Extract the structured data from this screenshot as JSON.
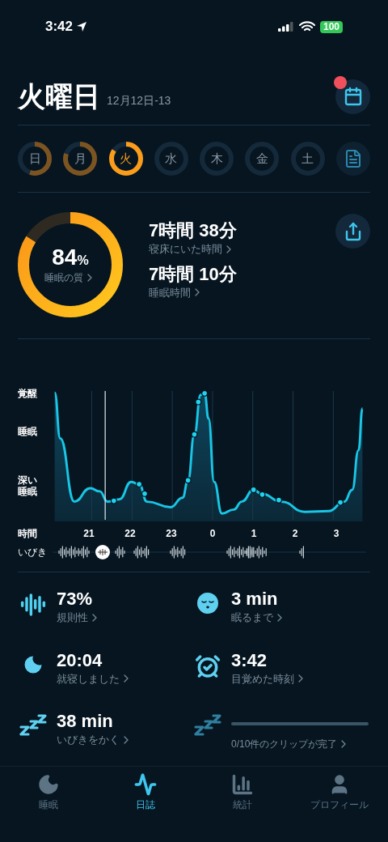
{
  "status_bar": {
    "time": "3:42",
    "battery": "100"
  },
  "header": {
    "title": "火曜日",
    "date": "12月12日-13",
    "notification": true
  },
  "days": [
    {
      "label": "日",
      "level": 0.55,
      "selected": false
    },
    {
      "label": "月",
      "level": 0.8,
      "selected": false
    },
    {
      "label": "火",
      "level": 0.84,
      "selected": true
    },
    {
      "label": "水",
      "level": 0,
      "selected": false
    },
    {
      "label": "木",
      "level": 0,
      "selected": false
    },
    {
      "label": "金",
      "level": 0,
      "selected": false
    },
    {
      "label": "土",
      "level": 0,
      "selected": false
    }
  ],
  "summary": {
    "quality": {
      "value": "84",
      "unit": "%",
      "label": "睡眠の質",
      "level": 0.84
    },
    "metrics": [
      {
        "value": "7時間 38分",
        "label": "寝床にいた時間"
      },
      {
        "value": "7時間 10分",
        "label": "睡眠時間"
      }
    ]
  },
  "chart": {
    "y_labels": [
      "覚醒",
      "睡眠",
      "深い睡眠"
    ],
    "x_label": "時間",
    "hours": [
      "21",
      "22",
      "23",
      "0",
      "1",
      "2",
      "3"
    ],
    "snore_label": "いびき"
  },
  "stats": [
    {
      "kind": "bars",
      "value": "73%",
      "label": "規則性"
    },
    {
      "kind": "sleepy",
      "value": "3 min",
      "label": "眠るまで"
    },
    {
      "kind": "moon",
      "value": "20:04",
      "label": "就寝しました"
    },
    {
      "kind": "alarm",
      "value": "3:42",
      "label": "目覚めた時刻"
    },
    {
      "kind": "zzz",
      "value": "38 min",
      "label": "いびきをかく"
    },
    {
      "kind": "clips",
      "label": "0/10件のクリップが完了",
      "level": 0
    }
  ],
  "tabs": [
    {
      "kind": "sleep",
      "label": "睡眠",
      "selected": false
    },
    {
      "kind": "journal",
      "label": "日誌",
      "selected": true
    },
    {
      "kind": "stats",
      "label": "統計",
      "selected": false
    },
    {
      "kind": "profile",
      "label": "プロフィール",
      "selected": false
    }
  ]
}
